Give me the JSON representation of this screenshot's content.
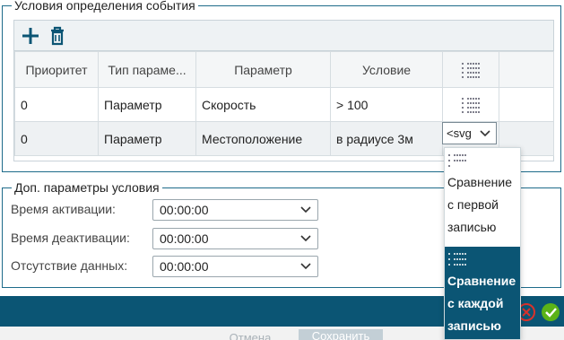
{
  "conditions": {
    "legend": "Условия определения события",
    "toolbar": {
      "add_icon": "plus-icon",
      "delete_icon": "trash-icon"
    },
    "columns": [
      "Приоритет",
      "Тип параме...",
      "Параметр",
      "Условие"
    ],
    "rows": [
      {
        "priority": "0",
        "type": "Параметр",
        "param": "Скорость",
        "condition": "> 100"
      },
      {
        "priority": "0",
        "type": "Параметр",
        "param": "Местоположение",
        "condition": "в радиусе 3м",
        "editor_value": "<svg"
      }
    ]
  },
  "extra": {
    "legend": "Доп. параметры условия",
    "fields": [
      {
        "label": "Время активации:",
        "value": "00:00:00"
      },
      {
        "label": "Время деактивации:",
        "value": "00:00:00"
      },
      {
        "label": "Отсутствие данных:",
        "value": "00:00:00"
      }
    ]
  },
  "dropdown": {
    "options": [
      {
        "text": "Сравнение с первой записью",
        "selected": false
      },
      {
        "text": "Сравнение с каждой записью",
        "selected": true
      }
    ]
  },
  "footer": {
    "cancel": "Отмена",
    "save": "Сохранить"
  },
  "colors": {
    "accent": "#0b5574",
    "border": "#1e6b8a",
    "ok": "#5bb318",
    "close": "#d9322b"
  }
}
